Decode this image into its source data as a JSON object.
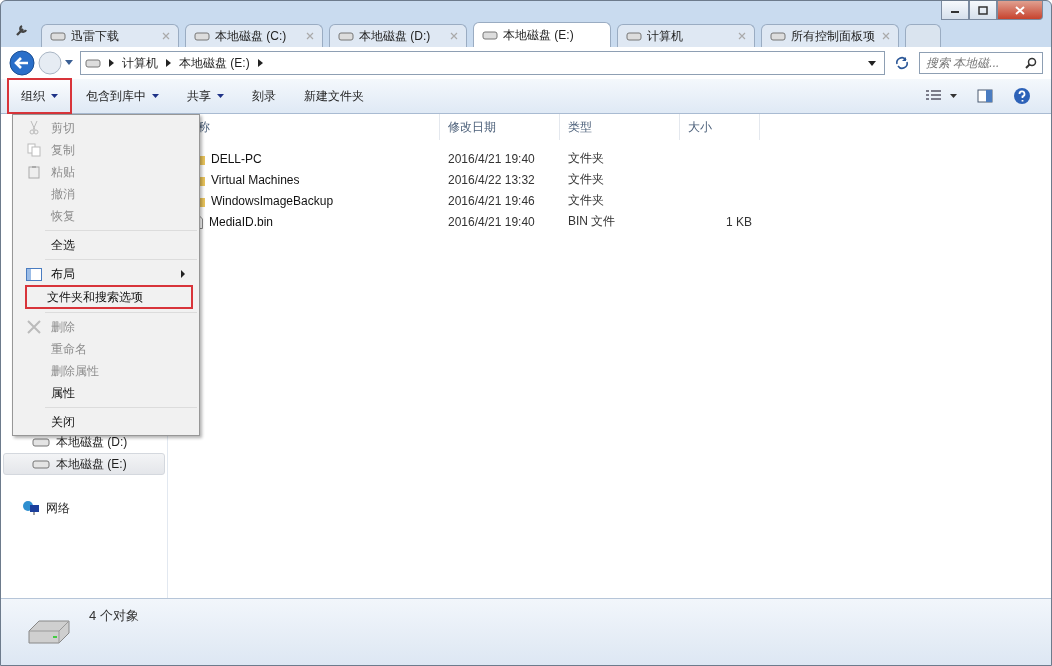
{
  "tabs": [
    {
      "label": "迅雷下载",
      "selected": false
    },
    {
      "label": "本地磁盘 (C:)",
      "selected": false
    },
    {
      "label": "本地磁盘 (D:)",
      "selected": false
    },
    {
      "label": "本地磁盘 (E:)",
      "selected": true
    },
    {
      "label": "计算机",
      "selected": false
    },
    {
      "label": "所有控制面板项",
      "selected": false
    }
  ],
  "address": {
    "crumbs": [
      "计算机",
      "本地磁盘 (E:)"
    ]
  },
  "search": {
    "placeholder": "搜索 本地磁..."
  },
  "toolbar": [
    {
      "label": "组织",
      "dropdown": true,
      "highlighted": true
    },
    {
      "label": "包含到库中",
      "dropdown": true,
      "highlighted": false
    },
    {
      "label": "共享",
      "dropdown": true,
      "highlighted": false
    },
    {
      "label": "刻录",
      "dropdown": false,
      "highlighted": false
    },
    {
      "label": "新建文件夹",
      "dropdown": false,
      "highlighted": false
    }
  ],
  "menu": {
    "groups": [
      [
        {
          "label": "剪切",
          "disabled": true,
          "highlighted": false,
          "submenu": false
        },
        {
          "label": "复制",
          "disabled": true,
          "highlighted": false,
          "submenu": false
        },
        {
          "label": "粘贴",
          "disabled": true,
          "highlighted": false,
          "submenu": false
        },
        {
          "label": "撤消",
          "disabled": true,
          "highlighted": false,
          "submenu": false
        },
        {
          "label": "恢复",
          "disabled": true,
          "highlighted": false,
          "submenu": false
        }
      ],
      [
        {
          "label": "全选",
          "disabled": false,
          "highlighted": false,
          "submenu": false
        }
      ],
      [
        {
          "label": "布局",
          "disabled": false,
          "highlighted": false,
          "submenu": true
        },
        {
          "label": "文件夹和搜索选项",
          "disabled": false,
          "highlighted": true,
          "submenu": false
        }
      ],
      [
        {
          "label": "删除",
          "disabled": true,
          "highlighted": false,
          "submenu": false
        },
        {
          "label": "重命名",
          "disabled": true,
          "highlighted": false,
          "submenu": false
        },
        {
          "label": "删除属性",
          "disabled": true,
          "highlighted": false,
          "submenu": false
        },
        {
          "label": "属性",
          "disabled": false,
          "highlighted": false,
          "submenu": false
        }
      ],
      [
        {
          "label": "关闭",
          "disabled": false,
          "highlighted": false,
          "submenu": false
        }
      ]
    ]
  },
  "sidebar": {
    "items": [
      {
        "label": "本地磁盘 (D:)",
        "kind": "drive",
        "selected": false
      },
      {
        "label": "本地磁盘 (E:)",
        "kind": "drive",
        "selected": true
      },
      {
        "label": "网络",
        "kind": "network",
        "selected": false
      }
    ]
  },
  "table": {
    "columns": [
      "称",
      "修改日期",
      "类型",
      "大小"
    ],
    "rows": [
      {
        "kind": "folder",
        "name": "DELL-PC",
        "date": "2016/4/21 19:40",
        "type": "文件夹",
        "size": ""
      },
      {
        "kind": "folder",
        "name": "Virtual Machines",
        "date": "2016/4/22 13:32",
        "type": "文件夹",
        "size": ""
      },
      {
        "kind": "folder",
        "name": "WindowsImageBackup",
        "date": "2016/4/21 19:46",
        "type": "文件夹",
        "size": ""
      },
      {
        "kind": "file",
        "name": "MediaID.bin",
        "date": "2016/4/21 19:40",
        "type": "BIN 文件",
        "size": "1 KB"
      }
    ]
  },
  "status_bar": {
    "count": "4 个对象"
  }
}
